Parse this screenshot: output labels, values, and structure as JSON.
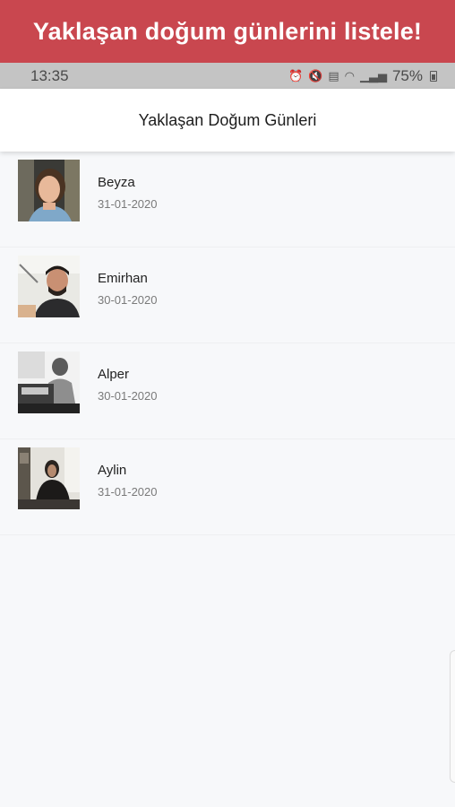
{
  "banner": {
    "text": "Yaklaşan doğum günlerini listele!",
    "color": "#c9474f"
  },
  "status_bar": {
    "time": "13:35",
    "battery": "75%"
  },
  "app_bar": {
    "title": "Yaklaşan Doğum Günleri"
  },
  "birthdays": [
    {
      "name": "Beyza",
      "date": "31-01-2020"
    },
    {
      "name": "Emirhan",
      "date": "30-01-2020"
    },
    {
      "name": "Alper",
      "date": "30-01-2020"
    },
    {
      "name": "Aylin",
      "date": "31-01-2020"
    }
  ]
}
